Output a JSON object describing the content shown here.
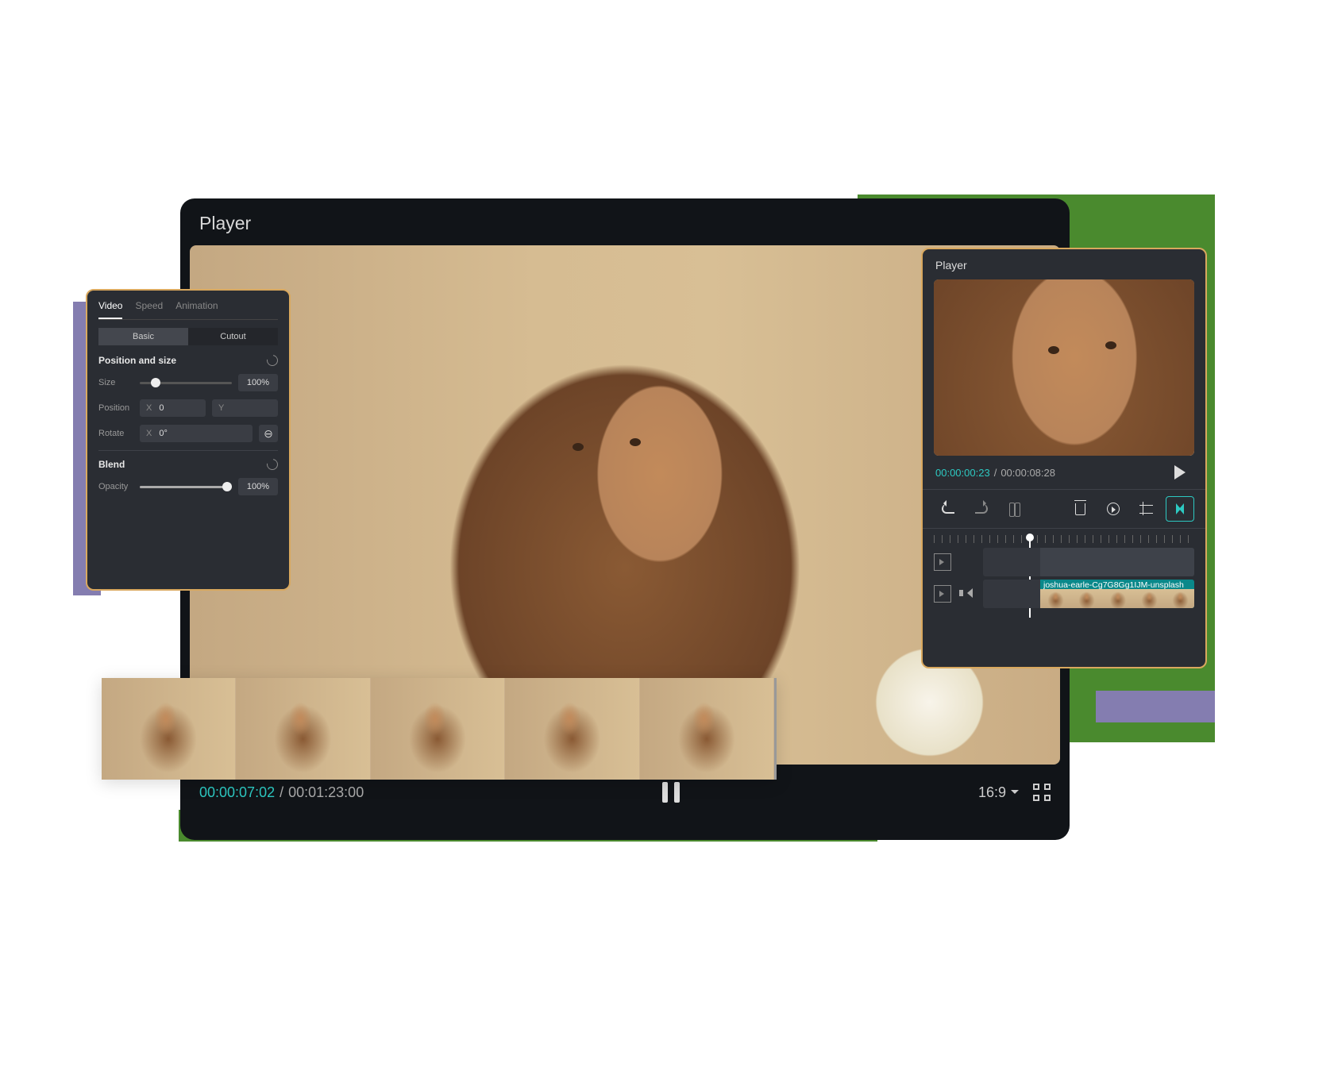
{
  "main_player": {
    "title": "Player",
    "timecode_current": "00:00:07:02",
    "timecode_total": "00:01:23:00",
    "aspect_ratio": "16:9"
  },
  "properties_panel": {
    "tabs": {
      "video": "Video",
      "speed": "Speed",
      "animation": "Animation"
    },
    "subtabs": {
      "basic": "Basic",
      "cutout": "Cutout"
    },
    "position_size": {
      "heading": "Position and size",
      "size_label": "Size",
      "size_value": "100%",
      "position_label": "Position",
      "position_x": "0",
      "position_y": "",
      "rotate_label": "Rotate",
      "rotate_value": "0°",
      "link_symbol": "⊖",
      "axis_x": "X",
      "axis_y": "Y"
    },
    "blend": {
      "heading": "Blend",
      "opacity_label": "Opacity",
      "opacity_value": "100%"
    }
  },
  "small_player": {
    "title": "Player",
    "timecode_current": "00:00:00:23",
    "timecode_total": "00:00:08:28",
    "clip_name": "joshua-earle-Cg7G8Gg1IJM-unsplash"
  }
}
